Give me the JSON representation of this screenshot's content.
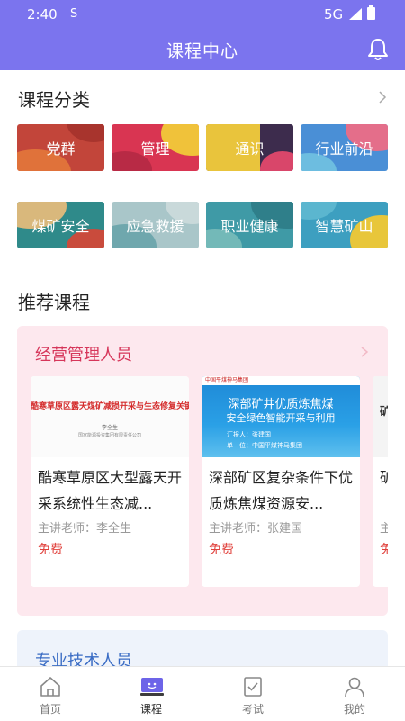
{
  "status": {
    "time": "2:40",
    "sim": "S",
    "network": "5G"
  },
  "header": {
    "title": "课程中心",
    "bell_icon": "bell-icon"
  },
  "categories": {
    "title": "课程分类",
    "items": [
      {
        "label": "党群",
        "color": "#c2453a"
      },
      {
        "label": "管理",
        "color": "#d93552"
      },
      {
        "label": "通识",
        "color": "#3d2c4d"
      },
      {
        "label": "行业前沿",
        "color": "#4a8fd6"
      },
      {
        "label": "煤矿安全",
        "color": "#2f8a8a"
      },
      {
        "label": "应急救援",
        "color": "#7fb5b8"
      },
      {
        "label": "职业健康",
        "color": "#3f9aa6"
      },
      {
        "label": "智慧矿山",
        "color": "#3d9fc0"
      }
    ]
  },
  "recommend": {
    "title": "推荐课程",
    "group1": {
      "title": "经营管理人员",
      "cards": [
        {
          "thumb_text": "酷寒草原区露天煤矿减损开采与生态修复关键技术",
          "thumb_sub1": "李全生",
          "thumb_sub2": "国家能源投资集团有限责任公司",
          "title": "酷寒草原区大型露天开采系统性生态减...",
          "teacher": "主讲老师：李全生",
          "price": "免费"
        },
        {
          "thumb_logo": "中国平煤神马集团",
          "thumb_text": "深部矿井优质炼焦煤",
          "thumb_text2": "安全绿色智能开采与利用",
          "thumb_sub1": "汇报人：张建国",
          "thumb_sub2": "单　位：中国平煤神马集团",
          "title": "深部矿区复杂条件下优质炼焦煤资源安...",
          "teacher": "主讲老师：张建国",
          "price": "免费"
        },
        {
          "thumb_text": "矿",
          "title": "矿和",
          "teacher": "主",
          "price": "免"
        }
      ]
    },
    "group2": {
      "title": "专业技术人员"
    }
  },
  "tabs": [
    {
      "label": "首页",
      "icon": "home-icon"
    },
    {
      "label": "课程",
      "icon": "course-icon",
      "active": true
    },
    {
      "label": "考试",
      "icon": "exam-icon"
    },
    {
      "label": "我的",
      "icon": "profile-icon"
    }
  ]
}
